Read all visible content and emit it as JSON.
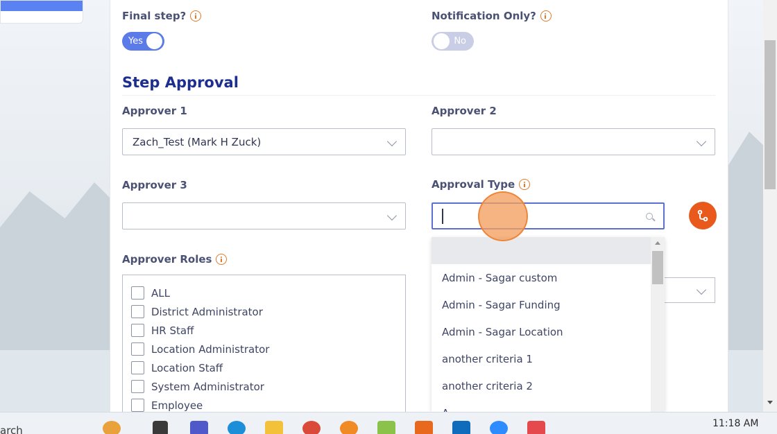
{
  "final_step": {
    "label": "Final step?",
    "toggle_label": "Yes"
  },
  "notification_only": {
    "label": "Notification Only?",
    "toggle_label": "No"
  },
  "section_title": "Step Approval",
  "approver1": {
    "label": "Approver 1",
    "value": "Zach_Test (Mark H Zuck)"
  },
  "approver2": {
    "label": "Approver 2",
    "value": ""
  },
  "approver3": {
    "label": "Approver 3",
    "value": ""
  },
  "approval_type": {
    "label": "Approval Type",
    "value": ""
  },
  "approver_roles": {
    "label": "Approver Roles",
    "items": [
      "ALL",
      "District Administrator",
      "HR Staff",
      "Location Administrator",
      "Location Staff",
      "System Administrator",
      "Employee"
    ]
  },
  "dropdown": {
    "items": [
      "Admin - Sagar custom",
      "Admin - Sagar Funding",
      "Admin - Sagar Location",
      "another criteria 1",
      "another criteria 2",
      "A"
    ]
  },
  "taskbar": {
    "search_text": "arch",
    "time": "11:18 AM"
  },
  "colors": {
    "accent": "#5b7be8",
    "brand_blue": "#1d2e8f",
    "orange": "#e8591b"
  }
}
